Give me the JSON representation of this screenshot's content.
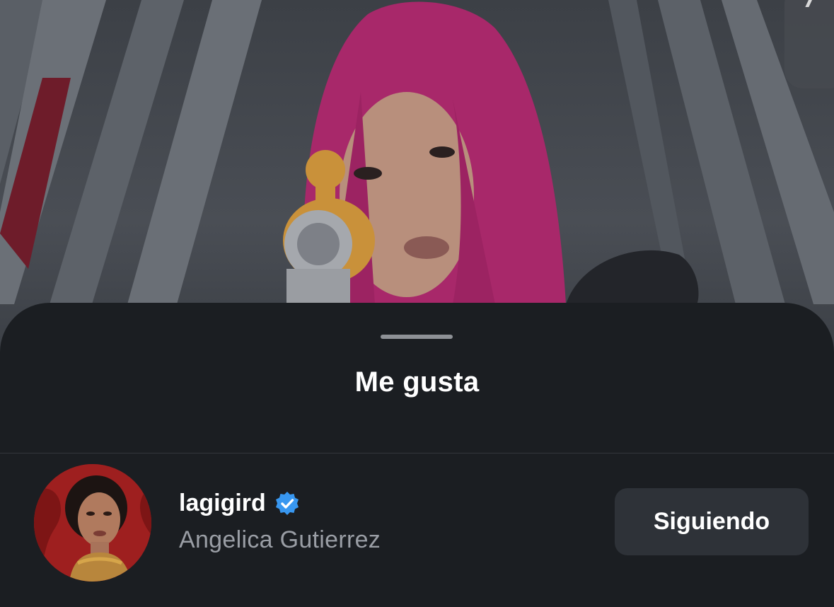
{
  "sheet": {
    "title": "Me gusta"
  },
  "likes": [
    {
      "username": "lagigird",
      "verified": true,
      "full_name": "Angelica Gutierrez",
      "follow_button_label": "Siguiendo"
    }
  ],
  "colors": {
    "sheet_background": "#1b1e22",
    "verified_badge": "#3897f0",
    "button_background": "#2e3238",
    "secondary_text": "#9a9ea5"
  },
  "icons": {
    "verified": "verified-badge-icon",
    "top_right": "chevron-icon"
  }
}
